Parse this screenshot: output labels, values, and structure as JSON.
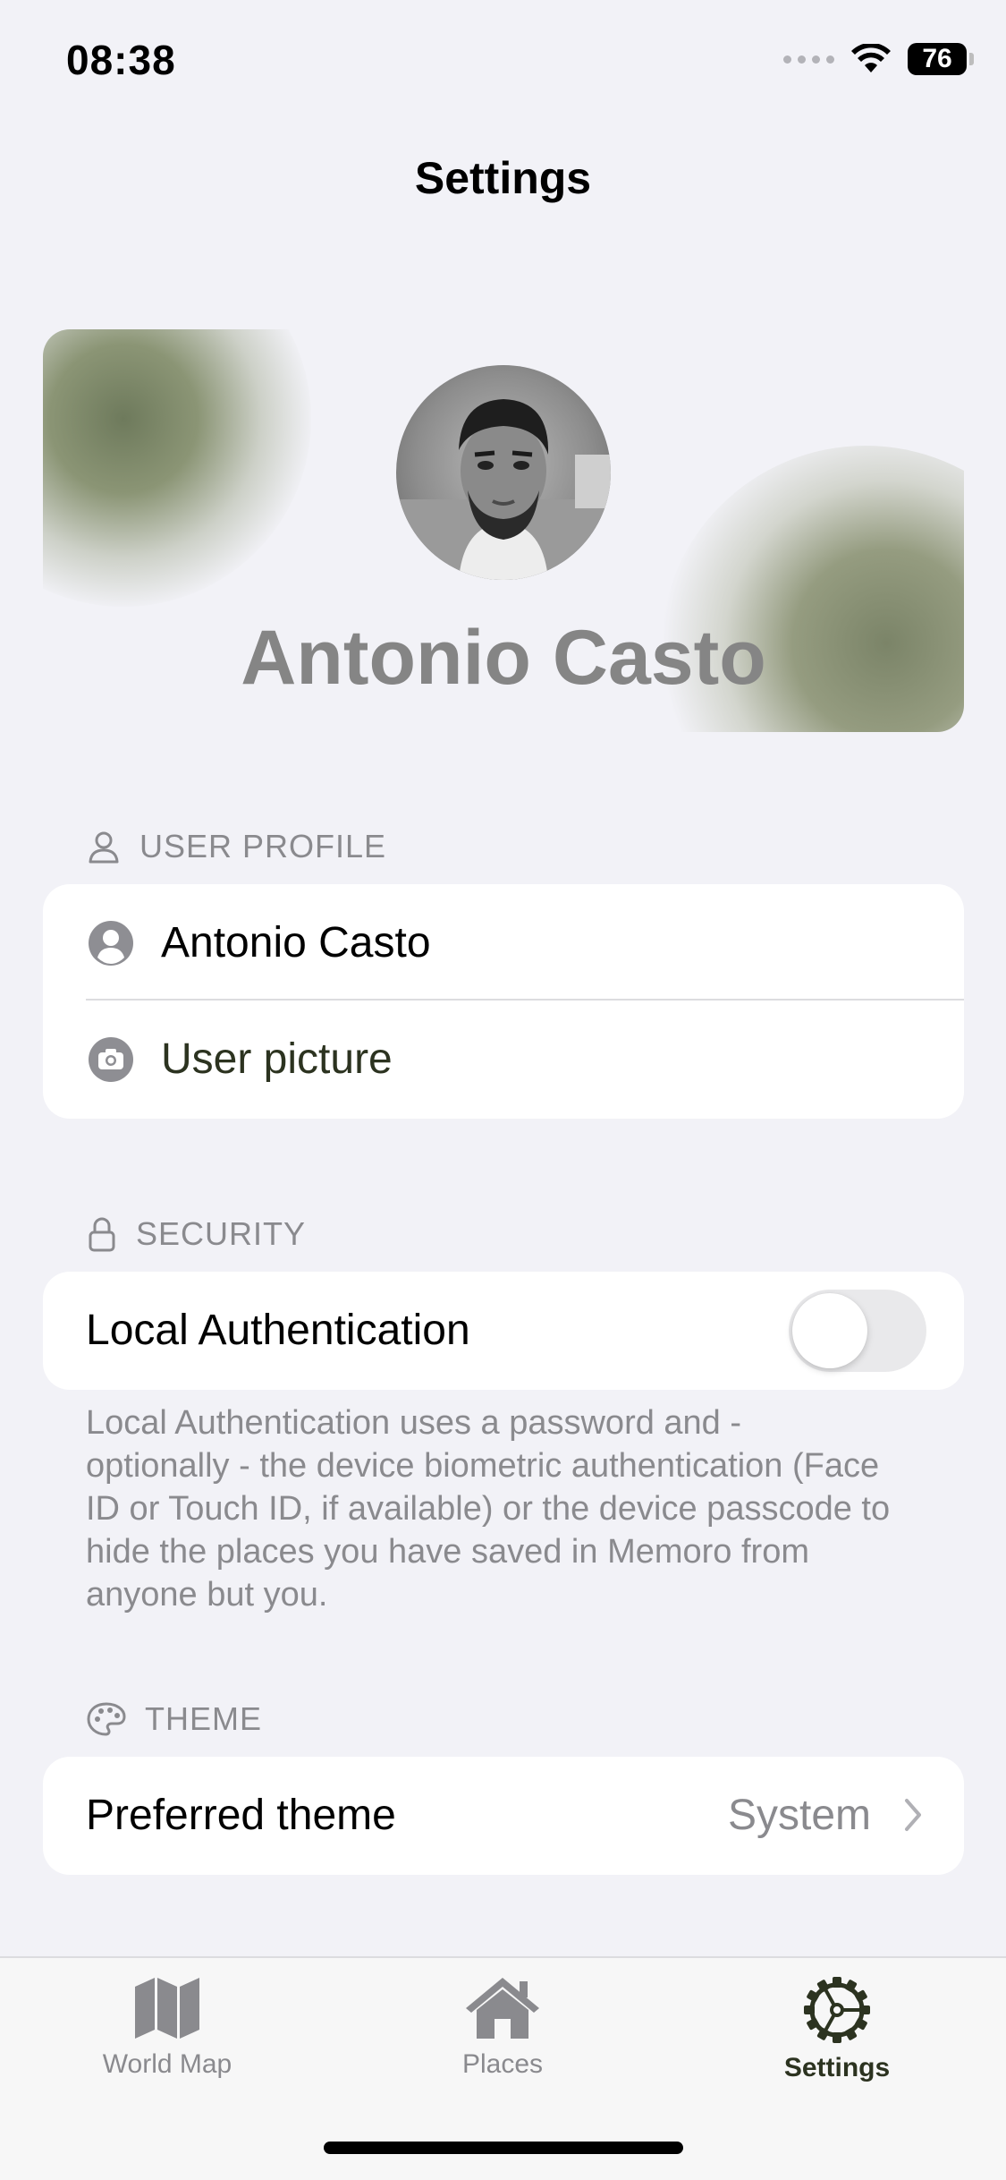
{
  "status_bar": {
    "time": "08:38",
    "battery": "76"
  },
  "nav": {
    "title": "Settings"
  },
  "profile_header": {
    "name": "Antonio Casto"
  },
  "user_profile_section": {
    "header": "USER PROFILE",
    "rows": [
      {
        "icon": "person-circle-icon",
        "label": "Antonio Casto"
      },
      {
        "icon": "camera-icon",
        "label": "User picture"
      }
    ]
  },
  "security_section": {
    "header": "SECURITY",
    "toggle_label": "Local Authentication",
    "toggle_on": false,
    "footer": "Local Authentication uses a password and - optionally - the device biometric authentication (Face ID or Touch ID, if available) or the device passcode to hide the places you have saved in Memoro from anyone but you."
  },
  "theme_section": {
    "header": "THEME",
    "row_label": "Preferred theme",
    "row_value": "System"
  },
  "tab_bar": {
    "tabs": [
      {
        "label": "World Map",
        "icon": "map-icon",
        "active": false
      },
      {
        "label": "Places",
        "icon": "house-icon",
        "active": false
      },
      {
        "label": "Settings",
        "icon": "gear-icon",
        "active": true
      }
    ]
  },
  "colors": {
    "accent": "#2c3320",
    "background": "#f2f2f7",
    "secondary_text": "#8a8a8e"
  }
}
